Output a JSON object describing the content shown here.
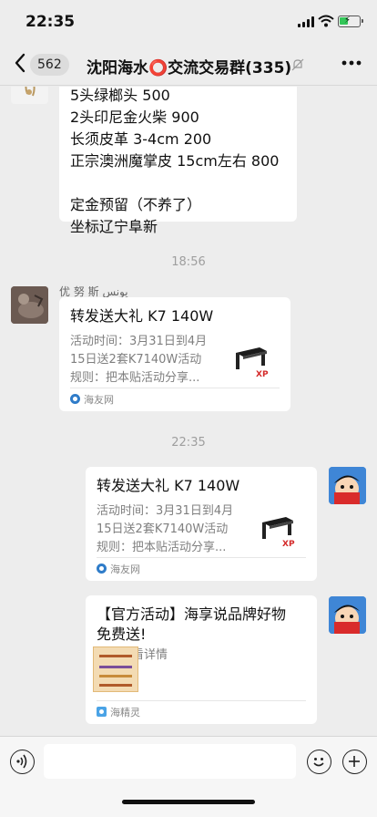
{
  "status_bar": {
    "time": "22:35",
    "battery_charging": true
  },
  "nav": {
    "back_count": "562",
    "title": "沈阳海水⭕交流交易群(335)",
    "muted": true
  },
  "messages": {
    "text_bubble": {
      "lines": [
        "5头绿榔头  500",
        "2头印尼金火柴 900",
        "长须皮革 3-4cm 200",
        "正宗澳洲魔掌皮 15cm左右 800",
        "",
        "定金预留（不养了）",
        "坐标辽宁阜新"
      ]
    },
    "timestamp_1": "18:56",
    "sender_name": "优 努 斯  يونس",
    "card_1": {
      "title": "转发送大礼 K7 140W",
      "desc": [
        "活动时间：3月31日到4月",
        "15日送2套K7140W活动",
        "规则：把本贴活动分享..."
      ],
      "source": "海友网"
    },
    "timestamp_2": "22:35",
    "card_2": {
      "title": "转发送大礼 K7 140W",
      "desc": [
        "活动时间：3月31日到4月",
        "15日送2套K7140W活动",
        "规则：把本贴活动分享..."
      ],
      "source": "海友网"
    },
    "card_3": {
      "title_lines": [
        "【官方活动】海享说品牌好物",
        "免费送!"
      ],
      "desc": [
        "点击查看详情"
      ],
      "source": "海精灵"
    }
  },
  "colors": {
    "background": "#ededed",
    "bubble": "#ffffff",
    "accent_red": "#d42a2a",
    "battery": "#34c759"
  }
}
